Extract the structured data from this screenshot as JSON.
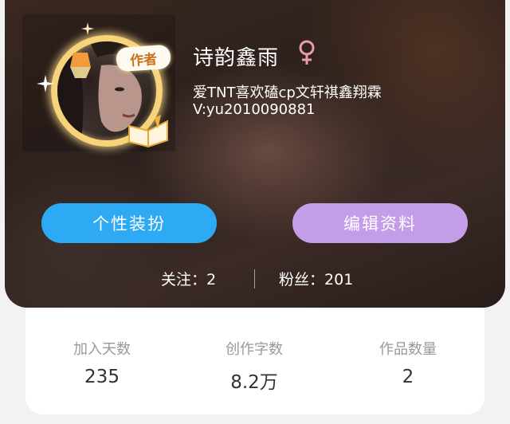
{
  "profile": {
    "name": "诗韵鑫雨",
    "author_badge": "作者",
    "gender_icon": "female-symbol-icon",
    "bio_line1": "爱TNT喜欢磕cp文轩祺鑫翔霖",
    "bio_line2": "V:yu2010090881"
  },
  "buttons": {
    "dress_up": "个性装扮",
    "edit_profile": "编辑资料"
  },
  "social": {
    "following_label": "关注：",
    "following_count": "2",
    "followers_label": "粉丝：",
    "followers_count": "201"
  },
  "stats": [
    {
      "label": "加入天数",
      "value": "235"
    },
    {
      "label": "创作字数",
      "value": "8.2万"
    },
    {
      "label": "作品数量",
      "value": "2"
    }
  ],
  "colors": {
    "dress_up_button": "#2eaaf5",
    "edit_button": "#c39de8",
    "gender_icon": "#ec9ab0",
    "avatar_ring": "#f7d37a"
  }
}
